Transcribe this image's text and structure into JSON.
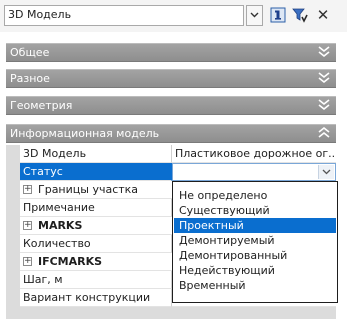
{
  "toolbar": {
    "selector_value": "3D Модель",
    "icons": [
      "chevron-down-icon",
      "quick-properties-icon",
      "select-filter-icon",
      "close-icon"
    ],
    "close_glyph": "✕"
  },
  "sections": [
    {
      "label": "Общее",
      "state": "collapsed"
    },
    {
      "label": "Разное",
      "state": "collapsed"
    },
    {
      "label": "Геометрия",
      "state": "collapsed"
    },
    {
      "label": "Информационная модель",
      "state": "expanded"
    }
  ],
  "properties": [
    {
      "name": "3D Модель",
      "value": "Пластиковое дорожное ог..."
    },
    {
      "name": "Статус",
      "value": ""
    },
    {
      "name": "Границы участка",
      "value": ""
    },
    {
      "name": "Примечание",
      "value": ""
    },
    {
      "name": "MARKS",
      "value": ""
    },
    {
      "name": "Количество",
      "value": ""
    },
    {
      "name": "IFCMARKS",
      "value": ""
    },
    {
      "name": "Шаг, м",
      "value": ""
    },
    {
      "name": "Вариант конструкции",
      "value": ""
    }
  ],
  "expand_glyph": "+",
  "status_dropdown": {
    "options": [
      "Не определено",
      "Существующий",
      "Проектный",
      "Демонтируемый",
      "Демонтированный",
      "Недействующий",
      "Временный"
    ],
    "highlighted": "Проектный"
  },
  "colors": {
    "section_header": "#999999",
    "selection": "#0a6ecf",
    "toolbar_bg": "#f4f4f4"
  }
}
